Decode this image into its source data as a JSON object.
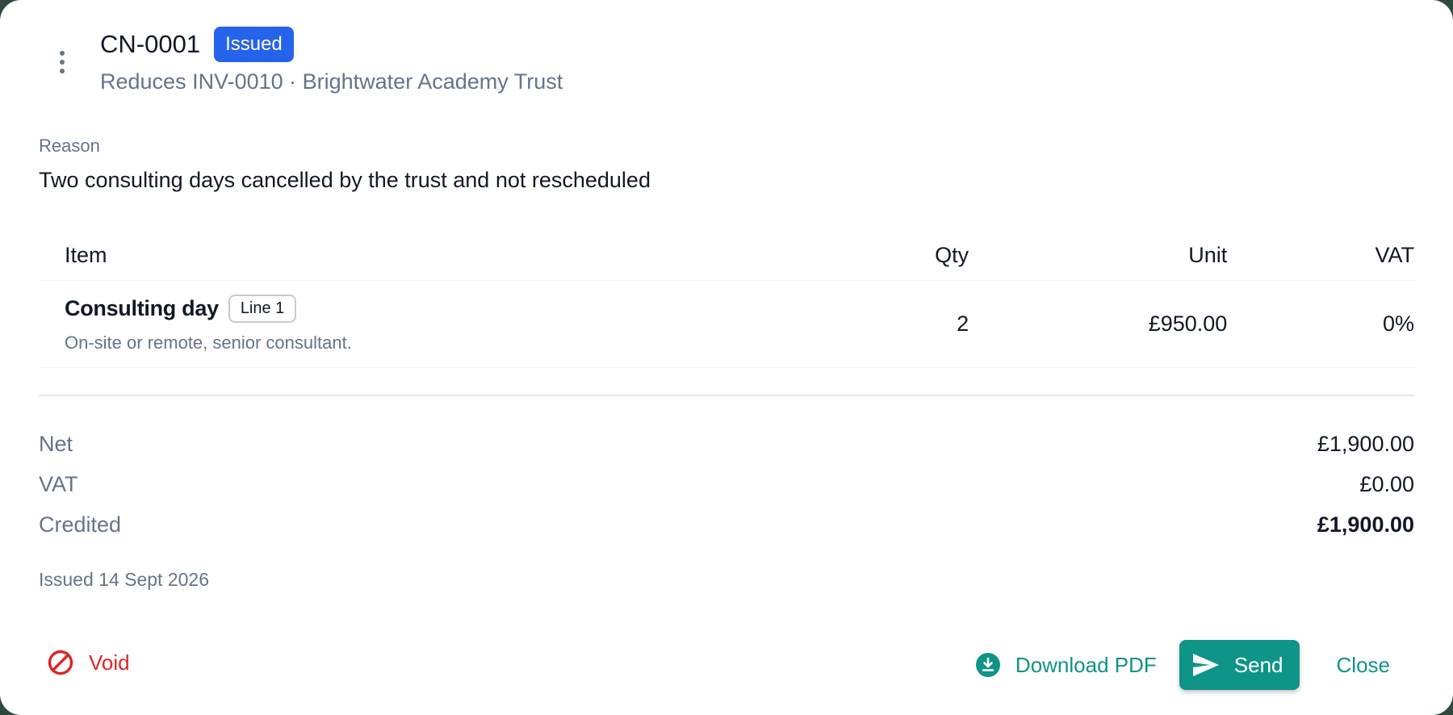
{
  "header": {
    "number": "CN-0001",
    "status": "Issued",
    "subtitle": "Reduces INV-0010 · Brightwater Academy Trust"
  },
  "reason": {
    "label": "Reason",
    "text": "Two consulting days cancelled by the trust and not rescheduled"
  },
  "table": {
    "columns": {
      "item": "Item",
      "qty": "Qty",
      "unit": "Unit",
      "vat": "VAT"
    },
    "rows": [
      {
        "name": "Consulting day",
        "line_badge": "Line 1",
        "description": "On-site or remote, senior consultant.",
        "qty": "2",
        "unit": "£950.00",
        "vat": "0%"
      }
    ]
  },
  "totals": {
    "net_label": "Net",
    "net_value": "£1,900.00",
    "vat_label": "VAT",
    "vat_value": "£0.00",
    "credited_label": "Credited",
    "credited_value": "£1,900.00"
  },
  "issued": "Issued 14 Sept 2026",
  "actions": {
    "void": "Void",
    "download": "Download PDF",
    "send": "Send",
    "close": "Close"
  },
  "colors": {
    "accent": "#0f9488",
    "status_badge": "#2563eb",
    "danger": "#dc2626"
  },
  "icons": {
    "menu": "more-vertical-icon",
    "void": "ban-icon",
    "download": "download-circle-icon",
    "send": "send-icon"
  }
}
